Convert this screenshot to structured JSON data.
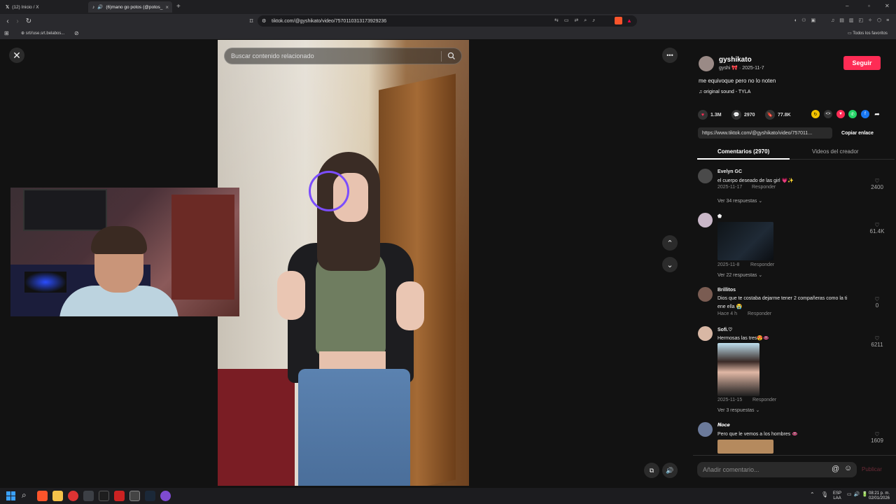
{
  "browser": {
    "tabs": [
      {
        "label": "(12) Inicio / X",
        "icon": "x-logo-icon"
      },
      {
        "label": "(6)mano go potos (@potos_",
        "icon": "tiktok-icon"
      }
    ],
    "url": "tiktok.com/@gyshikato/video/7570110313173929236",
    "bookmarks": [
      {
        "label": "srt//use.srt.belabos..."
      }
    ],
    "all_favorites": "Todos los favoritos"
  },
  "search": {
    "placeholder": "Buscar contenido relacionado"
  },
  "post": {
    "username": "gyshikato",
    "display_meta": "gyshi 🎀 · 2025-11-7",
    "follow_label": "Seguir",
    "caption": "me equivoque pero no lo noten",
    "sound": "original sound - TYLA",
    "stats": {
      "likes": "1.3M",
      "comments": "2970",
      "saves": "77.8K"
    },
    "link": "https://www.tiktok.com/@gyshikato/video/757011...",
    "copy_link_label": "Copiar enlace",
    "tabs": [
      {
        "label": "Comentarios (2970)"
      },
      {
        "label": "Videos del creador"
      }
    ]
  },
  "comments": [
    {
      "name": "Evelyn GC",
      "text": "el cuerpo deseado de las girl 💗✨",
      "date": "2025-11-17",
      "reply": "Responder",
      "likes": "2400",
      "replies": "Ver 34 respuestas"
    },
    {
      "name": "⬟",
      "text": "",
      "date": "2025-11-8",
      "reply": "Responder",
      "likes": "61.4K",
      "replies": "Ver 22 respuestas"
    },
    {
      "name": "Brillitos",
      "text": "Dios que te costaba dejarme tener 2 compañeras como la ti",
      "text2": "ene ella 😭",
      "date": "Hace 4 h",
      "reply": "Responder",
      "likes": "0"
    },
    {
      "name": "Sofi.♡",
      "text": "Hermosas las tres😍👄",
      "date": "2025-11-15",
      "reply": "Responder",
      "likes": "6211",
      "replies": "Ver 3 respuestas"
    },
    {
      "name": "𝑵𝒐𝒄𝒆",
      "text": "Pero que le vemos a los hombres 👄",
      "likes": "1609"
    }
  ],
  "comment_input": {
    "placeholder": "Añadir comentario...",
    "post_label": "Publicar"
  },
  "taskbar": {
    "lang": "ESP",
    "lang2": "LAA",
    "time": "08:21 p. m.",
    "date": "02/01/2026"
  },
  "colors": {
    "accent": "#fe2c55",
    "background": "#121212",
    "panel": "#121212"
  }
}
